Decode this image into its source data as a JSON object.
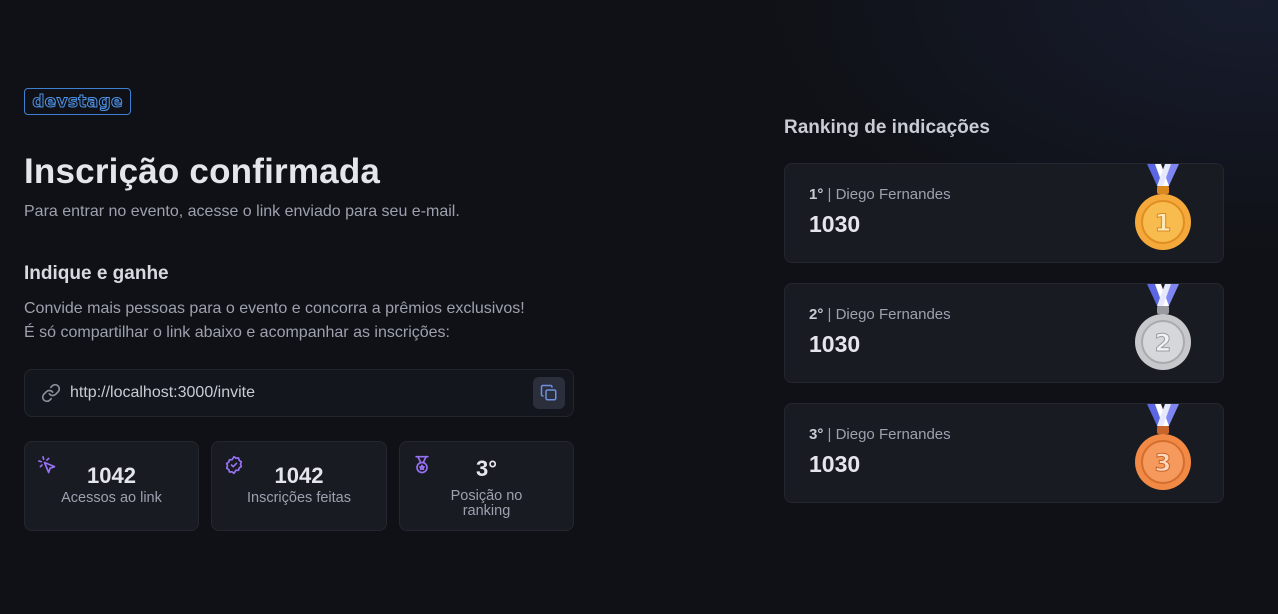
{
  "brand": {
    "logo_text": "devstage"
  },
  "header": {
    "title": "Inscrição confirmada",
    "subtitle": "Para entrar no evento, acesse o link enviado para seu e-mail."
  },
  "referral": {
    "title": "Indique e ganhe",
    "desc_line1": "Convide mais pessoas para o evento e concorra a prêmios exclusivos!",
    "desc_line2": "É só compartilhar o link abaixo e acompanhar as inscrições:",
    "link": "http://localhost:3000/invite",
    "icons": {
      "link": "link-icon",
      "copy": "copy-icon"
    }
  },
  "stats": [
    {
      "value": "1042",
      "label": "Acessos ao link",
      "icon": "cursor-click-icon"
    },
    {
      "value": "1042",
      "label": "Inscrições feitas",
      "icon": "badge-check-icon"
    },
    {
      "value": "3°",
      "label_line1": "Posição no",
      "label_line2": "ranking",
      "icon": "medal-icon"
    }
  ],
  "ranking": {
    "title": "Ranking de indicações",
    "items": [
      {
        "position": "1°",
        "name": "| Diego Fernandes",
        "score": "1030",
        "medal": "1",
        "medal_color": "#f4a93a"
      },
      {
        "position": "2°",
        "name": "| Diego Fernandes",
        "score": "1030",
        "medal": "2",
        "medal_color": "#c7c8cc"
      },
      {
        "position": "3°",
        "name": "| Diego Fernandes",
        "score": "1030",
        "medal": "3",
        "medal_color": "#f28a45"
      }
    ]
  },
  "colors": {
    "background": "#0f1116",
    "card": "#181b22",
    "accent": "#9871f5",
    "logo_blue": "#4f93e8"
  }
}
